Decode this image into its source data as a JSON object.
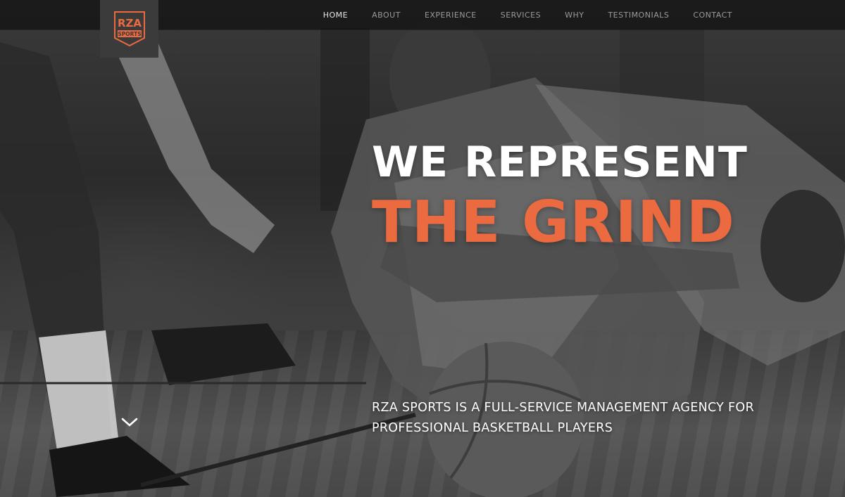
{
  "brand": {
    "logo_top": "RZA",
    "logo_bottom": "SPORTS",
    "accent": "#ec6a3f"
  },
  "nav": {
    "items": [
      {
        "label": "HOME",
        "active": true
      },
      {
        "label": "ABOUT",
        "active": false
      },
      {
        "label": "EXPERIENCE",
        "active": false
      },
      {
        "label": "SERVICES",
        "active": false
      },
      {
        "label": "WHY",
        "active": false
      },
      {
        "label": "TESTIMONIALS",
        "active": false
      },
      {
        "label": "CONTACT",
        "active": false
      }
    ]
  },
  "hero": {
    "headline_line1": "WE REPRESENT",
    "headline_line2": "THE GRIND",
    "tagline_line1": "RZA SPORTS IS A FULL-SERVICE MANAGEMENT AGENCY FOR",
    "tagline_line2": "PROFESSIONAL BASKETBALL PLAYERS",
    "scroll_icon": "chevron-down-icon"
  }
}
